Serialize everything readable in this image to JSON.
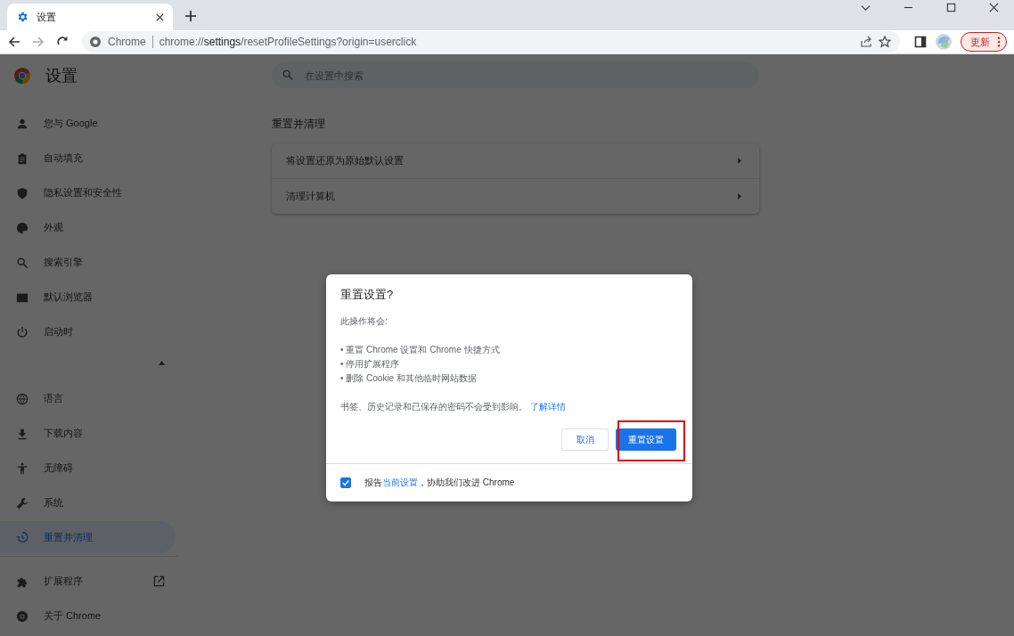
{
  "tab": {
    "title": "设置"
  },
  "toolbar": {
    "site_label": "Chrome",
    "url": "chrome://**settings**/resetProfileSettings?origin=userclick",
    "update_button": "更新"
  },
  "settings": {
    "title": "设置",
    "search": {
      "placeholder": "在设置中搜索"
    },
    "nav": [
      {
        "label": "您与 Google",
        "kind": "person",
        "selected": false
      },
      {
        "label": "自动填充",
        "kind": "clipboard",
        "selected": false
      },
      {
        "label": "隐私设置和安全性",
        "kind": "shield",
        "selected": false
      },
      {
        "label": "外观",
        "kind": "palette",
        "selected": false
      },
      {
        "label": "搜索引擎",
        "kind": "search",
        "selected": false
      },
      {
        "label": "默认浏览器",
        "kind": "browser",
        "selected": false
      },
      {
        "label": "启动时",
        "kind": "power",
        "selected": false
      }
    ],
    "advanced": {
      "expanded": true
    },
    "advanced_nav": [
      {
        "label": "语言",
        "kind": "globe",
        "selected": false
      },
      {
        "label": "下载内容",
        "kind": "download",
        "selected": false
      },
      {
        "label": "无障碍",
        "kind": "accessibility",
        "selected": false
      },
      {
        "label": "系统",
        "kind": "wrench",
        "selected": false
      },
      {
        "label": "重置并清理",
        "kind": "history",
        "selected": true
      }
    ],
    "footer_nav": [
      {
        "label": "扩展程序",
        "kind": "puzzle",
        "external": true
      },
      {
        "label": "关于 Chrome",
        "kind": "chrome",
        "external": false
      }
    ],
    "section_title": "重置并清理",
    "rows": [
      "将设置还原为原始默认设置",
      "清理计算机"
    ]
  },
  "dialog": {
    "title": "重置设置?",
    "intro": "此操作将会:",
    "bullets": [
      "• 重置 Chrome 设置和 Chrome 快捷方式",
      "• 停用扩展程序",
      "• 删除 Cookie 和其他临时网站数据"
    ],
    "note": "书签、历史记录和已保存的密码不会受到影响。",
    "link": "了解详情",
    "cancel_button": "取消",
    "confirm_button": "重置设置",
    "confirm_highlighted": true,
    "report": {
      "checked": true,
      "prefix": "报告",
      "link": "当前设置",
      "suffix": "，协助我们改进 Chrome"
    }
  }
}
